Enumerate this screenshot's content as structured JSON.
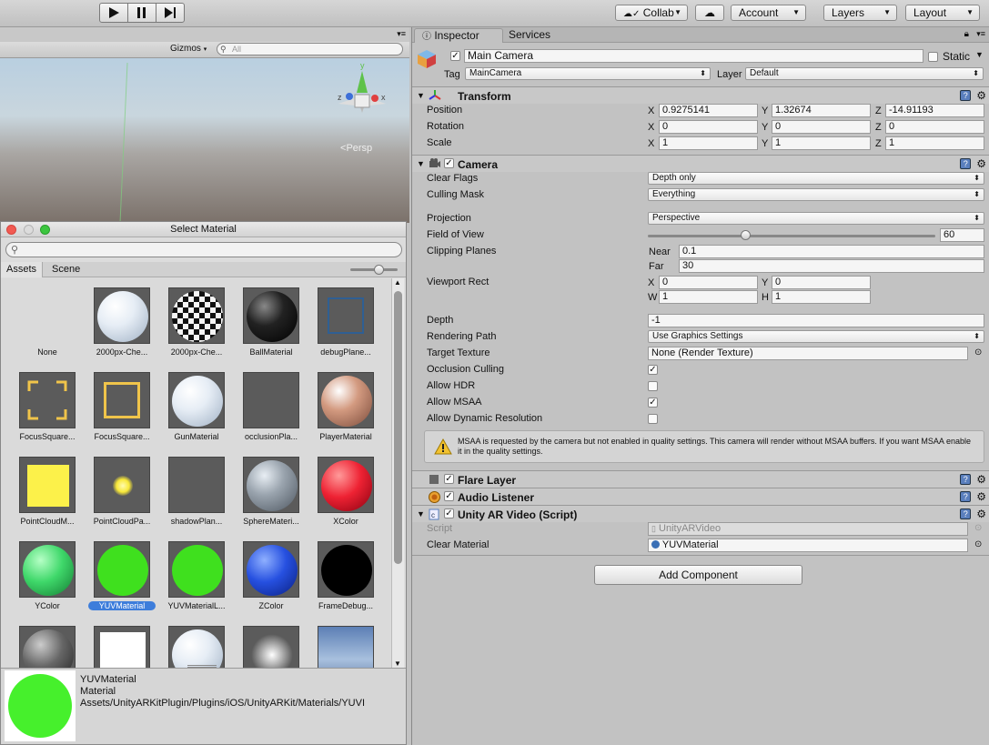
{
  "toolbar": {
    "collab_label": "Collab",
    "account_label": "Account",
    "layers_label": "Layers",
    "layout_label": "Layout"
  },
  "scene": {
    "gizmos_label": "Gizmos",
    "search_placeholder": "All",
    "persp_label": "Persp",
    "gizmo_axes": {
      "x": "x",
      "y": "y",
      "z": "z"
    }
  },
  "select_material": {
    "title": "Select Material",
    "tabs": [
      "Assets",
      "Scene"
    ],
    "items": [
      {
        "label": "None",
        "thumb": "none"
      },
      {
        "label": "2000px-Che...",
        "thumb": "sphere-white"
      },
      {
        "label": "2000px-Che...",
        "thumb": "sphere-checker"
      },
      {
        "label": "BallMaterial",
        "thumb": "sphere-black"
      },
      {
        "label": "debugPlane...",
        "thumb": "square-outline-blue"
      },
      {
        "label": "FocusSquare...",
        "thumb": "focus-corners"
      },
      {
        "label": "FocusSquare...",
        "thumb": "focus-square"
      },
      {
        "label": "GunMaterial",
        "thumb": "sphere-white"
      },
      {
        "label": "occlusionPla...",
        "thumb": "gray-square"
      },
      {
        "label": "PlayerMaterial",
        "thumb": "sphere-player"
      },
      {
        "label": "PointCloudM...",
        "thumb": "yellow-square"
      },
      {
        "label": "PointCloudPa...",
        "thumb": "yellow-dot"
      },
      {
        "label": "shadowPlan...",
        "thumb": "gray-square"
      },
      {
        "label": "SphereMateri...",
        "thumb": "sphere-gray"
      },
      {
        "label": "XColor",
        "thumb": "sphere-red"
      },
      {
        "label": "YColor",
        "thumb": "sphere-green-lit"
      },
      {
        "label": "YUVMaterial",
        "thumb": "circle-green",
        "selected": true
      },
      {
        "label": "YUVMaterialL...",
        "thumb": "circle-green"
      },
      {
        "label": "ZColor",
        "thumb": "sphere-blue"
      },
      {
        "label": "FrameDebug...",
        "thumb": "circle-black"
      },
      {
        "label": "",
        "thumb": "sphere-dark"
      },
      {
        "label": "",
        "thumb": "white-square"
      },
      {
        "label": "",
        "thumb": "sphere-white"
      },
      {
        "label": "",
        "thumb": "glow"
      },
      {
        "label": "",
        "thumb": "sky"
      }
    ],
    "preview": {
      "name": "YUVMaterial",
      "type": "Material",
      "path": "Assets/UnityARKitPlugin/Plugins/iOS/UnityARKit/Materials/YUVI"
    }
  },
  "inspector": {
    "tabs": [
      "Inspector",
      "Services"
    ],
    "object_name": "Main Camera",
    "static_label": "Static",
    "tag_label": "Tag",
    "tag_value": "MainCamera",
    "layer_label": "Layer",
    "layer_value": "Default",
    "transform": {
      "title": "Transform",
      "rows": [
        {
          "label": "Position",
          "x": "0.9275141",
          "y": "1.32674",
          "z": "-14.91193"
        },
        {
          "label": "Rotation",
          "x": "0",
          "y": "0",
          "z": "0"
        },
        {
          "label": "Scale",
          "x": "1",
          "y": "1",
          "z": "1"
        }
      ]
    },
    "camera": {
      "title": "Camera",
      "clear_flags_label": "Clear Flags",
      "clear_flags_value": "Depth only",
      "culling_mask_label": "Culling Mask",
      "culling_mask_value": "Everything",
      "projection_label": "Projection",
      "projection_value": "Perspective",
      "fov_label": "Field of View",
      "fov_value": "60",
      "fov_fraction": 0.34,
      "clipping_label": "Clipping Planes",
      "near_label": "Near",
      "near_value": "0.1",
      "far_label": "Far",
      "far_value": "30",
      "viewport_label": "Viewport Rect",
      "vp_x": "0",
      "vp_y": "0",
      "vp_w": "1",
      "vp_h": "1",
      "depth_label": "Depth",
      "depth_value": "-1",
      "rendering_path_label": "Rendering Path",
      "rendering_path_value": "Use Graphics Settings",
      "target_texture_label": "Target Texture",
      "target_texture_value": "None (Render Texture)",
      "occlusion_label": "Occlusion Culling",
      "hdr_label": "Allow HDR",
      "msaa_label": "Allow MSAA",
      "dynres_label": "Allow Dynamic Resolution",
      "warning": "MSAA is requested by the camera but not enabled in quality settings. This camera will render without MSAA buffers. If you want MSAA enable it in the quality settings."
    },
    "flare_layer": "Flare Layer",
    "audio_listener": "Audio Listener",
    "ar_video": {
      "title": "Unity AR Video (Script)",
      "script_label": "Script",
      "script_value": "UnityARVideo",
      "clear_material_label": "Clear Material",
      "clear_material_value": "YUVMaterial"
    },
    "add_component": "Add Component"
  }
}
